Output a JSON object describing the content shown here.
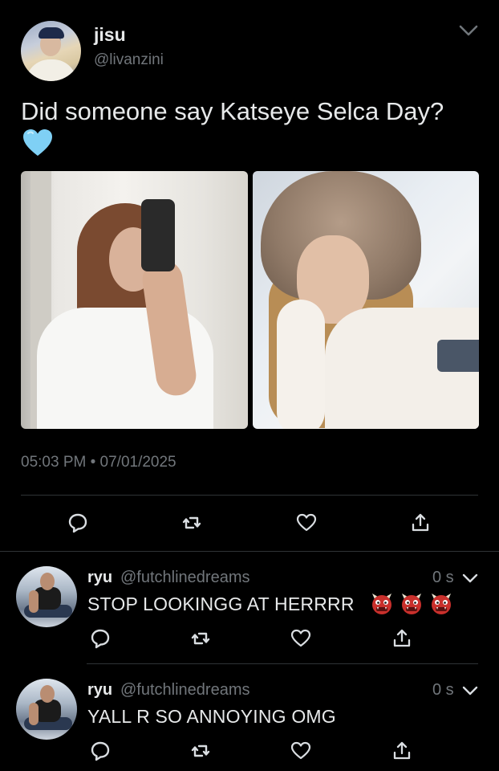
{
  "tweet": {
    "display_name": "jisu",
    "username": "@livanzini",
    "text": "Did someone say Katseye Selca Day?",
    "emoji": "light-blue-heart",
    "timestamp": "05:03 PM • 07/01/2025",
    "accent_color": "#71767b"
  },
  "replies": [
    {
      "display_name": "ryu",
      "username": "@futchlinedreams",
      "time": "0 s",
      "text": "STOP LOOKINGG AT HERRRR",
      "emoji_count": 3,
      "emoji": "ogre-face"
    },
    {
      "display_name": "ryu",
      "username": "@futchlinedreams",
      "time": "0 s",
      "text": "YALL R SO ANNOYING OMG"
    }
  ],
  "icons": {
    "reply": "speech-bubble-icon",
    "retweet": "retweet-icon",
    "like": "heart-icon",
    "share": "share-icon",
    "menu": "chevron-down-icon"
  }
}
